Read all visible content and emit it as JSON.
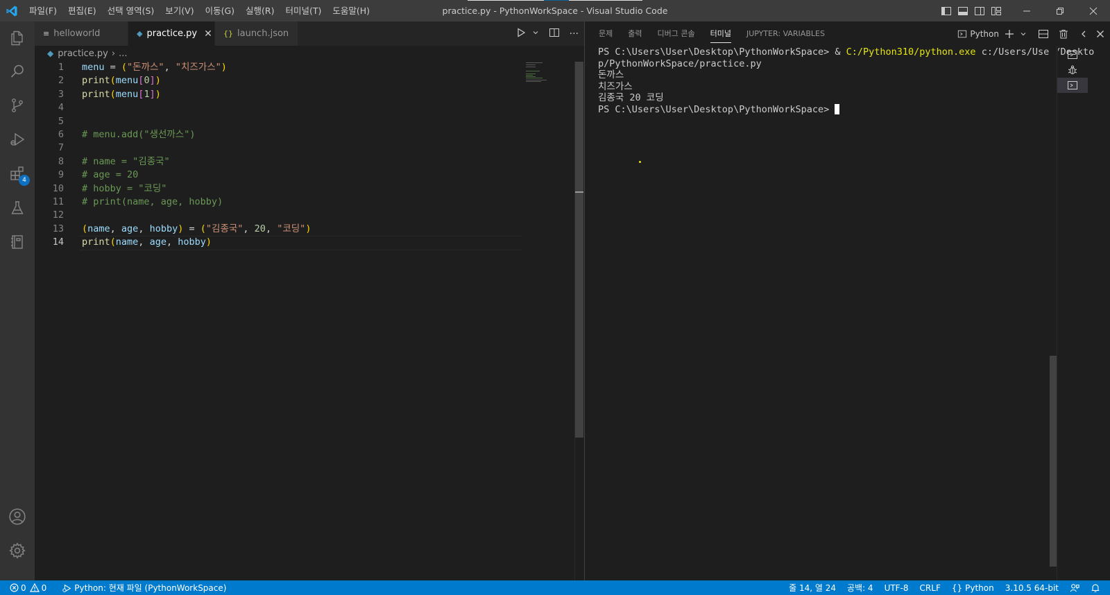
{
  "window": {
    "title": "practice.py - PythonWorkSpace - Visual Studio Code"
  },
  "menu": [
    "파일(F)",
    "편집(E)",
    "선택 영역(S)",
    "보기(V)",
    "이동(G)",
    "실행(R)",
    "터미널(T)",
    "도움말(H)"
  ],
  "activity_bar": {
    "items": [
      {
        "name": "explorer-icon"
      },
      {
        "name": "search-icon"
      },
      {
        "name": "source-control-icon"
      },
      {
        "name": "run-debug-icon"
      },
      {
        "name": "extensions-icon",
        "badge": "4"
      },
      {
        "name": "testing-icon"
      },
      {
        "name": "notebook-icon"
      }
    ],
    "bottom": [
      {
        "name": "account-icon"
      },
      {
        "name": "settings-gear-icon"
      }
    ]
  },
  "editor": {
    "tabs": [
      {
        "label": "helloworld",
        "icon": "≡",
        "active": false
      },
      {
        "label": "practice.py",
        "icon": "python",
        "active": true
      },
      {
        "label": "launch.json",
        "icon": "{}",
        "active": false
      }
    ],
    "breadcrumb": {
      "file": "practice.py",
      "more": "..."
    },
    "current_line": 14,
    "lines": [
      {
        "n": "1",
        "tokens": [
          {
            "t": "menu",
            "c": "var"
          },
          {
            "t": " = ",
            "c": "op"
          },
          {
            "t": "(",
            "c": "br1"
          },
          {
            "t": "\"돈까스\"",
            "c": "str"
          },
          {
            "t": ", ",
            "c": "op"
          },
          {
            "t": "\"치즈가스\"",
            "c": "str"
          },
          {
            "t": ")",
            "c": "br1"
          }
        ]
      },
      {
        "n": "2",
        "tokens": [
          {
            "t": "print",
            "c": "fn"
          },
          {
            "t": "(",
            "c": "br1"
          },
          {
            "t": "menu",
            "c": "var"
          },
          {
            "t": "[",
            "c": "br2"
          },
          {
            "t": "0",
            "c": "num"
          },
          {
            "t": "]",
            "c": "br2"
          },
          {
            "t": ")",
            "c": "br1"
          }
        ]
      },
      {
        "n": "3",
        "tokens": [
          {
            "t": "print",
            "c": "fn"
          },
          {
            "t": "(",
            "c": "br1"
          },
          {
            "t": "menu",
            "c": "var"
          },
          {
            "t": "[",
            "c": "br2"
          },
          {
            "t": "1",
            "c": "num"
          },
          {
            "t": "]",
            "c": "br2"
          },
          {
            "t": ")",
            "c": "br1"
          }
        ]
      },
      {
        "n": "4",
        "tokens": []
      },
      {
        "n": "5",
        "tokens": []
      },
      {
        "n": "6",
        "tokens": [
          {
            "t": "# menu.add(\"생선까스\")",
            "c": "cmt"
          }
        ]
      },
      {
        "n": "7",
        "tokens": []
      },
      {
        "n": "8",
        "tokens": [
          {
            "t": "# name = \"김종국\"",
            "c": "cmt"
          }
        ]
      },
      {
        "n": "9",
        "tokens": [
          {
            "t": "# age = 20",
            "c": "cmt"
          }
        ]
      },
      {
        "n": "10",
        "tokens": [
          {
            "t": "# hobby = \"코딩\"",
            "c": "cmt"
          }
        ]
      },
      {
        "n": "11",
        "tokens": [
          {
            "t": "# print(name, age, hobby)",
            "c": "cmt"
          }
        ]
      },
      {
        "n": "12",
        "tokens": []
      },
      {
        "n": "13",
        "tokens": [
          {
            "t": "(",
            "c": "br1"
          },
          {
            "t": "name",
            "c": "var"
          },
          {
            "t": ", ",
            "c": "op"
          },
          {
            "t": "age",
            "c": "var"
          },
          {
            "t": ", ",
            "c": "op"
          },
          {
            "t": "hobby",
            "c": "var"
          },
          {
            "t": ")",
            "c": "br1"
          },
          {
            "t": " = ",
            "c": "op"
          },
          {
            "t": "(",
            "c": "br1"
          },
          {
            "t": "\"김종국\"",
            "c": "str"
          },
          {
            "t": ", ",
            "c": "op"
          },
          {
            "t": "20",
            "c": "num"
          },
          {
            "t": ", ",
            "c": "op"
          },
          {
            "t": "\"코딩\"",
            "c": "str"
          },
          {
            "t": ")",
            "c": "br1"
          }
        ]
      },
      {
        "n": "14",
        "tokens": [
          {
            "t": "print",
            "c": "fn"
          },
          {
            "t": "(",
            "c": "br1"
          },
          {
            "t": "name",
            "c": "var"
          },
          {
            "t": ", ",
            "c": "op"
          },
          {
            "t": "age",
            "c": "var"
          },
          {
            "t": ", ",
            "c": "op"
          },
          {
            "t": "hobby",
            "c": "var"
          },
          {
            "t": ")",
            "c": "br1"
          }
        ]
      }
    ]
  },
  "panel": {
    "tabs": [
      {
        "label": "문제",
        "active": false
      },
      {
        "label": "출력",
        "active": false
      },
      {
        "label": "디버그 콘솔",
        "active": false
      },
      {
        "label": "터미널",
        "active": true
      },
      {
        "label": "JUPYTER: VARIABLES",
        "active": false
      }
    ],
    "terminal_profile": "Python",
    "terminal": {
      "cmd_prompt": "PS C:\\Users\\User\\Desktop\\PythonWorkSpace> & ",
      "cmd_exe": "C:/Python310/python.exe",
      "cmd_arg1": " c:/Users/User/Deskto",
      "cmd_arg2": "p/PythonWorkSpace/practice.py",
      "out1": "돈까스",
      "out2": "치즈가스",
      "out3": "김종국 20 코딩",
      "prompt": "PS C:\\Users\\User\\Desktop\\PythonWorkSpace> "
    }
  },
  "status": {
    "errors": "0",
    "warnings": "0",
    "debug_config": "Python: 현재 파일 (PythonWorkSpace)",
    "position": "줄 14, 열 24",
    "spaces": "공백: 4",
    "encoding": "UTF-8",
    "eol": "CRLF",
    "language": "Python",
    "interpreter": "3.10.5 64-bit"
  },
  "colors": {
    "statusbar": "#007acc",
    "accent": "#0e70c0"
  }
}
